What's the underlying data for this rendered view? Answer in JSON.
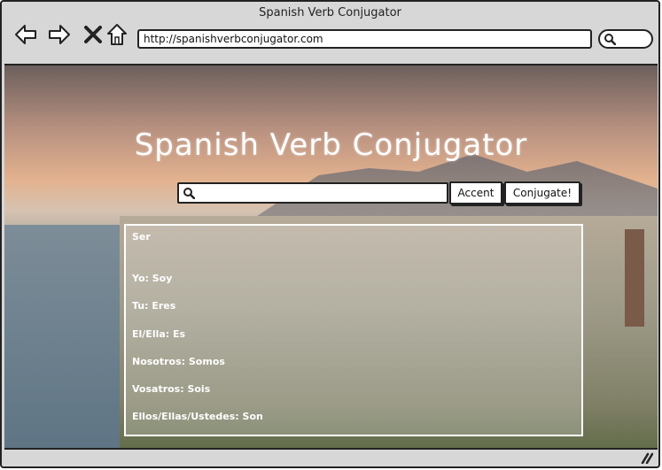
{
  "window": {
    "title": "Spanish Verb Conjugator"
  },
  "toolbar": {
    "url": "http://spanishverbconjugator.com"
  },
  "page": {
    "heading": "Spanish Verb Conjugator",
    "search": {
      "value": "",
      "placeholder": ""
    },
    "accent_label": "Accent",
    "conjugate_label": "Conjugate!"
  },
  "results": {
    "verb": "Ser",
    "rows": [
      "Yo: Soy",
      "Tu: Eres",
      "El/Ella: Es",
      "Nosotros: Somos",
      "Vosatros: Sois",
      "Ellos/Ellas/Ustedes: Son"
    ]
  }
}
